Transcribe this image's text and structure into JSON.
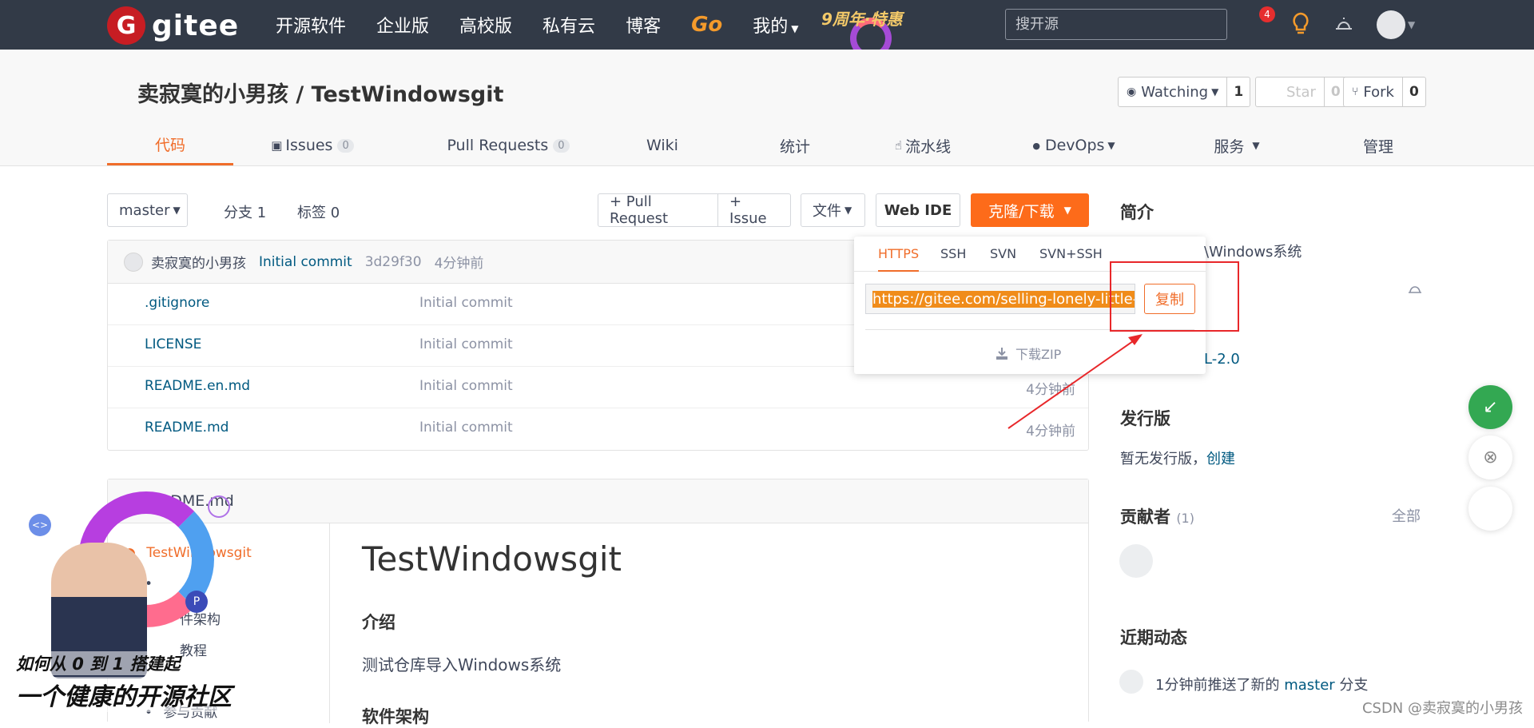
{
  "nav": {
    "logo_mark": "G",
    "logo_text": "gitee",
    "items": [
      "开源软件",
      "企业版",
      "高校版",
      "私有云",
      "博客"
    ],
    "go": "Go",
    "mine": "我的",
    "promo": "9周年·特惠",
    "search_placeholder": "搜开源",
    "notif_count": "4"
  },
  "repo": {
    "title": "卖寂寞的小男孩 / TestWindowsgit",
    "watch_label": "Watching",
    "watch_count": "1",
    "star_label": "Star",
    "star_count": "0",
    "fork_label": "Fork",
    "fork_count": "0",
    "tabs": [
      {
        "label": "代码"
      },
      {
        "label": "Issues",
        "count": "0"
      },
      {
        "label": "Pull Requests",
        "count": "0"
      },
      {
        "label": "Wiki"
      },
      {
        "label": "统计"
      },
      {
        "label": "流水线"
      },
      {
        "label": "DevOps"
      },
      {
        "label": "服务"
      },
      {
        "label": "管理"
      }
    ]
  },
  "toolbar": {
    "branch": "master",
    "branches": "分支 1",
    "tags": "标签 0",
    "pull_request": "+ Pull Request",
    "issue": "+ Issue",
    "file": "文件",
    "web_ide": "Web IDE",
    "clone": "克隆/下载"
  },
  "commit": {
    "author": "卖寂寞的小男孩",
    "message": "Initial commit",
    "hash": "3d29f30",
    "time": "4分钟前"
  },
  "files": [
    {
      "name": ".gitignore",
      "commit": "Initial commit",
      "time": ""
    },
    {
      "name": "LICENSE",
      "commit": "Initial commit",
      "time": ""
    },
    {
      "name": "README.en.md",
      "commit": "Initial commit",
      "time": "4分钟前"
    },
    {
      "name": "README.md",
      "commit": "Initial commit",
      "time": "4分钟前"
    }
  ],
  "clone_popover": {
    "tabs": [
      "HTTPS",
      "SSH",
      "SVN",
      "SVN+SSH"
    ],
    "url": "https://gitee.com/selling-lonely-little-b",
    "copy": "复制",
    "download_zip": "下载ZIP"
  },
  "readme": {
    "header": "README.md",
    "toc": [
      "TestWindowsgit",
      "件架构",
      "教程",
      "参与贡献"
    ],
    "h1": "TestWindowsgit",
    "intro_h": "介绍",
    "intro_p": "测试仓库导入Windows系统",
    "arch_h": "软件架构"
  },
  "sidebar": {
    "intro_h": "简介",
    "intro_text": "\\Windows系统",
    "license": "L-2.0",
    "release_h": "发行版",
    "release_text": "暂无发行版，",
    "release_link": "创建",
    "contrib_h": "贡献者",
    "contrib_count": "(1)",
    "contrib_all": "全部",
    "activity_h": "近期动态",
    "activity_prefix": "1分钟前推送了新的 ",
    "activity_branch": "master",
    "activity_suffix": " 分支"
  },
  "ad": {
    "line1": "如何从 0 到 1 搭建起",
    "line2": "一个健康的开源社区"
  },
  "watermark": "CSDN @卖寂寞的小男孩",
  "colors": {
    "accent": "#f06d2a",
    "clone_button": "#fd6b1a",
    "nav_bg": "#323a47",
    "annotation": "#e8272a"
  }
}
